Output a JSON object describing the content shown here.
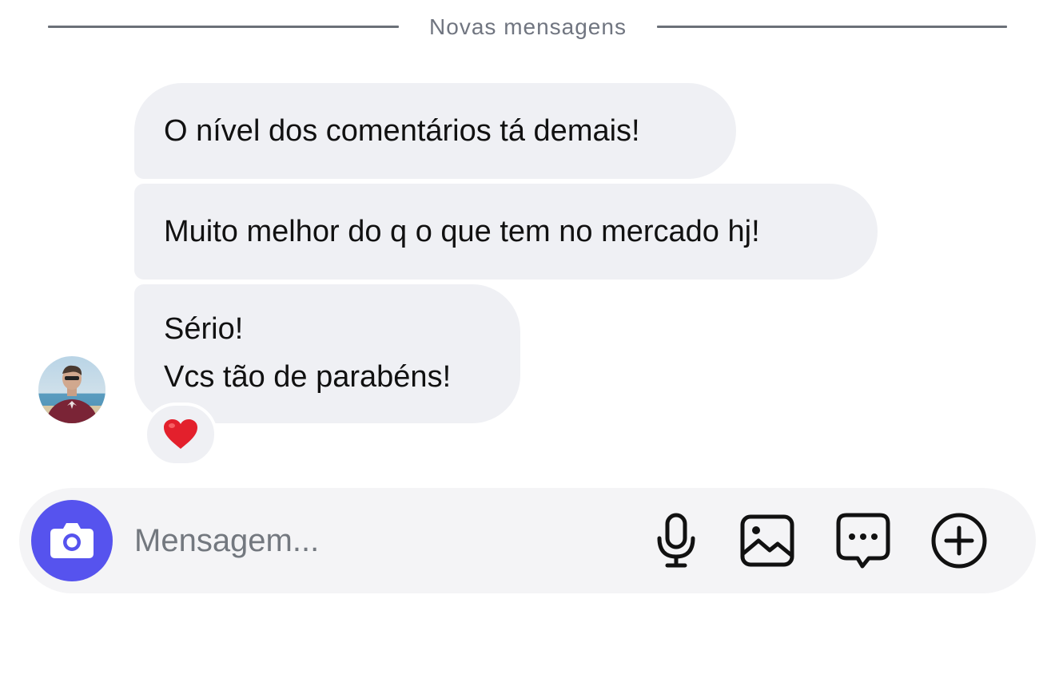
{
  "divider": {
    "label": "Novas mensagens"
  },
  "messages": [
    {
      "lines": [
        "O nível dos comentários tá demais!"
      ]
    },
    {
      "lines": [
        "Muito melhor do q o que tem no mercado hj!"
      ]
    },
    {
      "lines": [
        "Sério!",
        "Vcs tão de parabéns!"
      ],
      "reaction": "❤️"
    }
  ],
  "composer": {
    "placeholder": "Mensagem...",
    "accent_color": "#5653ee",
    "icons": [
      "camera-icon",
      "microphone-icon",
      "image-icon",
      "chat-bubble-icon",
      "plus-circle-icon"
    ]
  },
  "colors": {
    "bubble": "#eff0f4",
    "composer_bg": "#f4f4f6",
    "divider": "#6b7078"
  }
}
